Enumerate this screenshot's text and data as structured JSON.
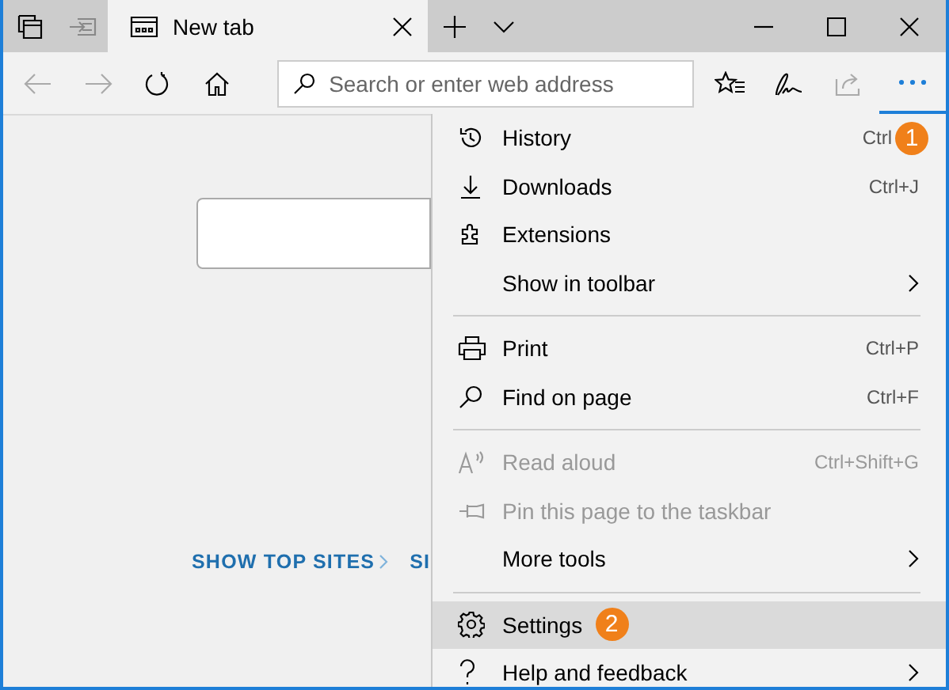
{
  "tabs": [
    {
      "label": "New tab",
      "selected": true
    }
  ],
  "address": {
    "placeholder": "Search or enter web address"
  },
  "page": {
    "links": [
      "SHOW TOP SITES",
      "SI"
    ]
  },
  "menu": {
    "items": [
      {
        "kind": "item",
        "label": "History",
        "shortcut": "Ctrl",
        "badge": "1",
        "disabled": false,
        "submenu": false,
        "selected": false
      },
      {
        "kind": "item",
        "label": "Downloads",
        "shortcut": "Ctrl+J",
        "disabled": false,
        "submenu": false,
        "selected": false
      },
      {
        "kind": "item",
        "label": "Extensions",
        "disabled": false,
        "submenu": false,
        "selected": false
      },
      {
        "kind": "item",
        "label": "Show in toolbar",
        "disabled": false,
        "submenu": true,
        "selected": false
      },
      {
        "kind": "separator"
      },
      {
        "kind": "item",
        "label": "Print",
        "shortcut": "Ctrl+P",
        "disabled": false,
        "submenu": false,
        "selected": false
      },
      {
        "kind": "item",
        "label": "Find on page",
        "shortcut": "Ctrl+F",
        "disabled": false,
        "submenu": false,
        "selected": false
      },
      {
        "kind": "separator"
      },
      {
        "kind": "item",
        "label": "Read aloud",
        "shortcut": "Ctrl+Shift+G",
        "disabled": true,
        "submenu": false,
        "selected": false
      },
      {
        "kind": "item",
        "label": "Pin this page to the taskbar",
        "disabled": true,
        "submenu": false,
        "selected": false
      },
      {
        "kind": "item",
        "label": "More tools",
        "disabled": false,
        "submenu": true,
        "selected": false
      },
      {
        "kind": "separator"
      },
      {
        "kind": "item",
        "label": "Settings",
        "badge": "2",
        "disabled": false,
        "submenu": false,
        "selected": true
      },
      {
        "kind": "item",
        "label": "Help and feedback",
        "disabled": false,
        "submenu": true,
        "selected": false
      }
    ]
  }
}
